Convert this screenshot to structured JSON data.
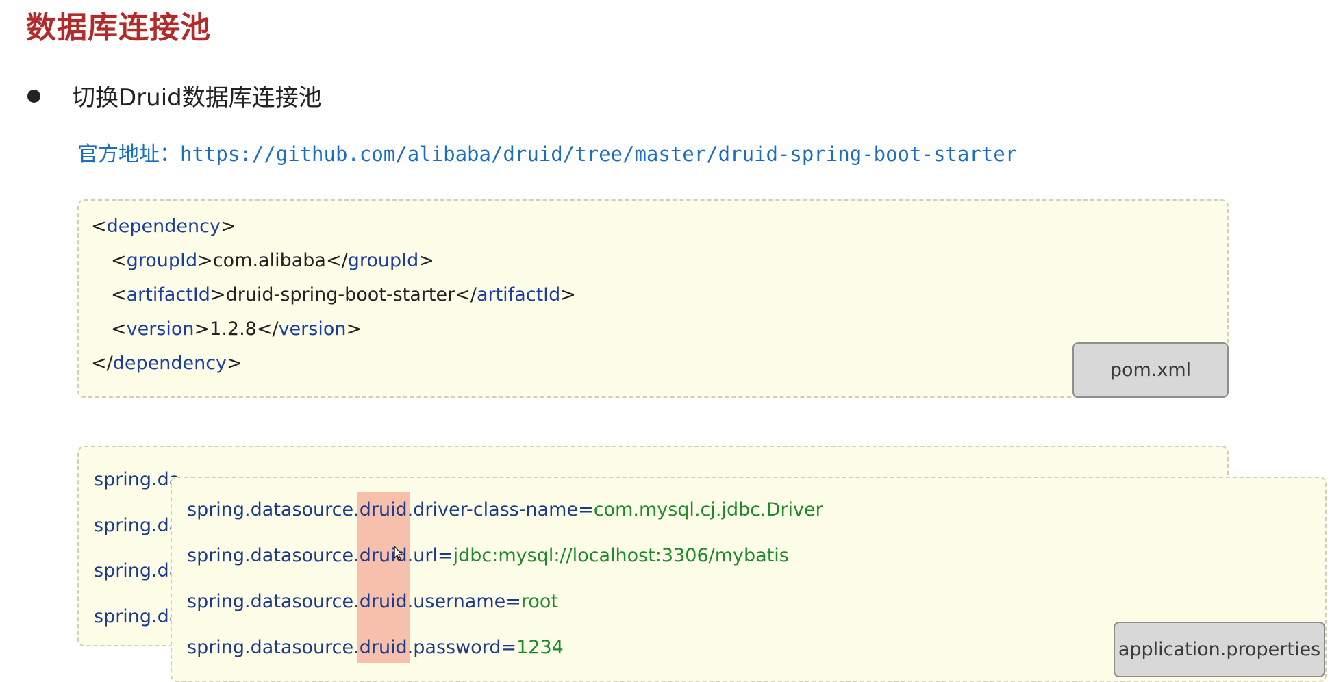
{
  "title": "数据库连接池",
  "bullet": "切换Druid数据库连接池",
  "official": {
    "label": "官方地址：",
    "url": "https://github.com/alibaba/druid/tree/master/druid-spring-boot-starter"
  },
  "pom": {
    "filename": "pom.xml",
    "dependency_tag": "dependency",
    "groupId_tag": "groupId",
    "groupId": "com.alibaba",
    "artifactId_tag": "artifactId",
    "artifactId": "druid-spring-boot-starter",
    "version_tag": "version",
    "version": "1.2.8"
  },
  "props_back": {
    "visible_prefix": [
      "spring.da",
      "spring.da",
      "spring.da",
      "spring.da"
    ]
  },
  "props": {
    "filename": "application.properties",
    "prefix": "spring.datasource.",
    "highlight": "druid.",
    "lines": [
      {
        "key": "driver-class-name",
        "value": "com.mysql.cj.jdbc.Driver"
      },
      {
        "key": "url",
        "value": "jdbc:mysql://localhost:3306/mybatis"
      },
      {
        "key": "username",
        "value": "root"
      },
      {
        "key": "password",
        "value": "1234"
      }
    ]
  },
  "colors": {
    "title": "#b22a2a",
    "link": "#1a6ec0",
    "tag": "#1a3ea0",
    "value": "#1a8a2a",
    "highlight": "#f6c0ad",
    "box_bg": "#fefde7"
  }
}
